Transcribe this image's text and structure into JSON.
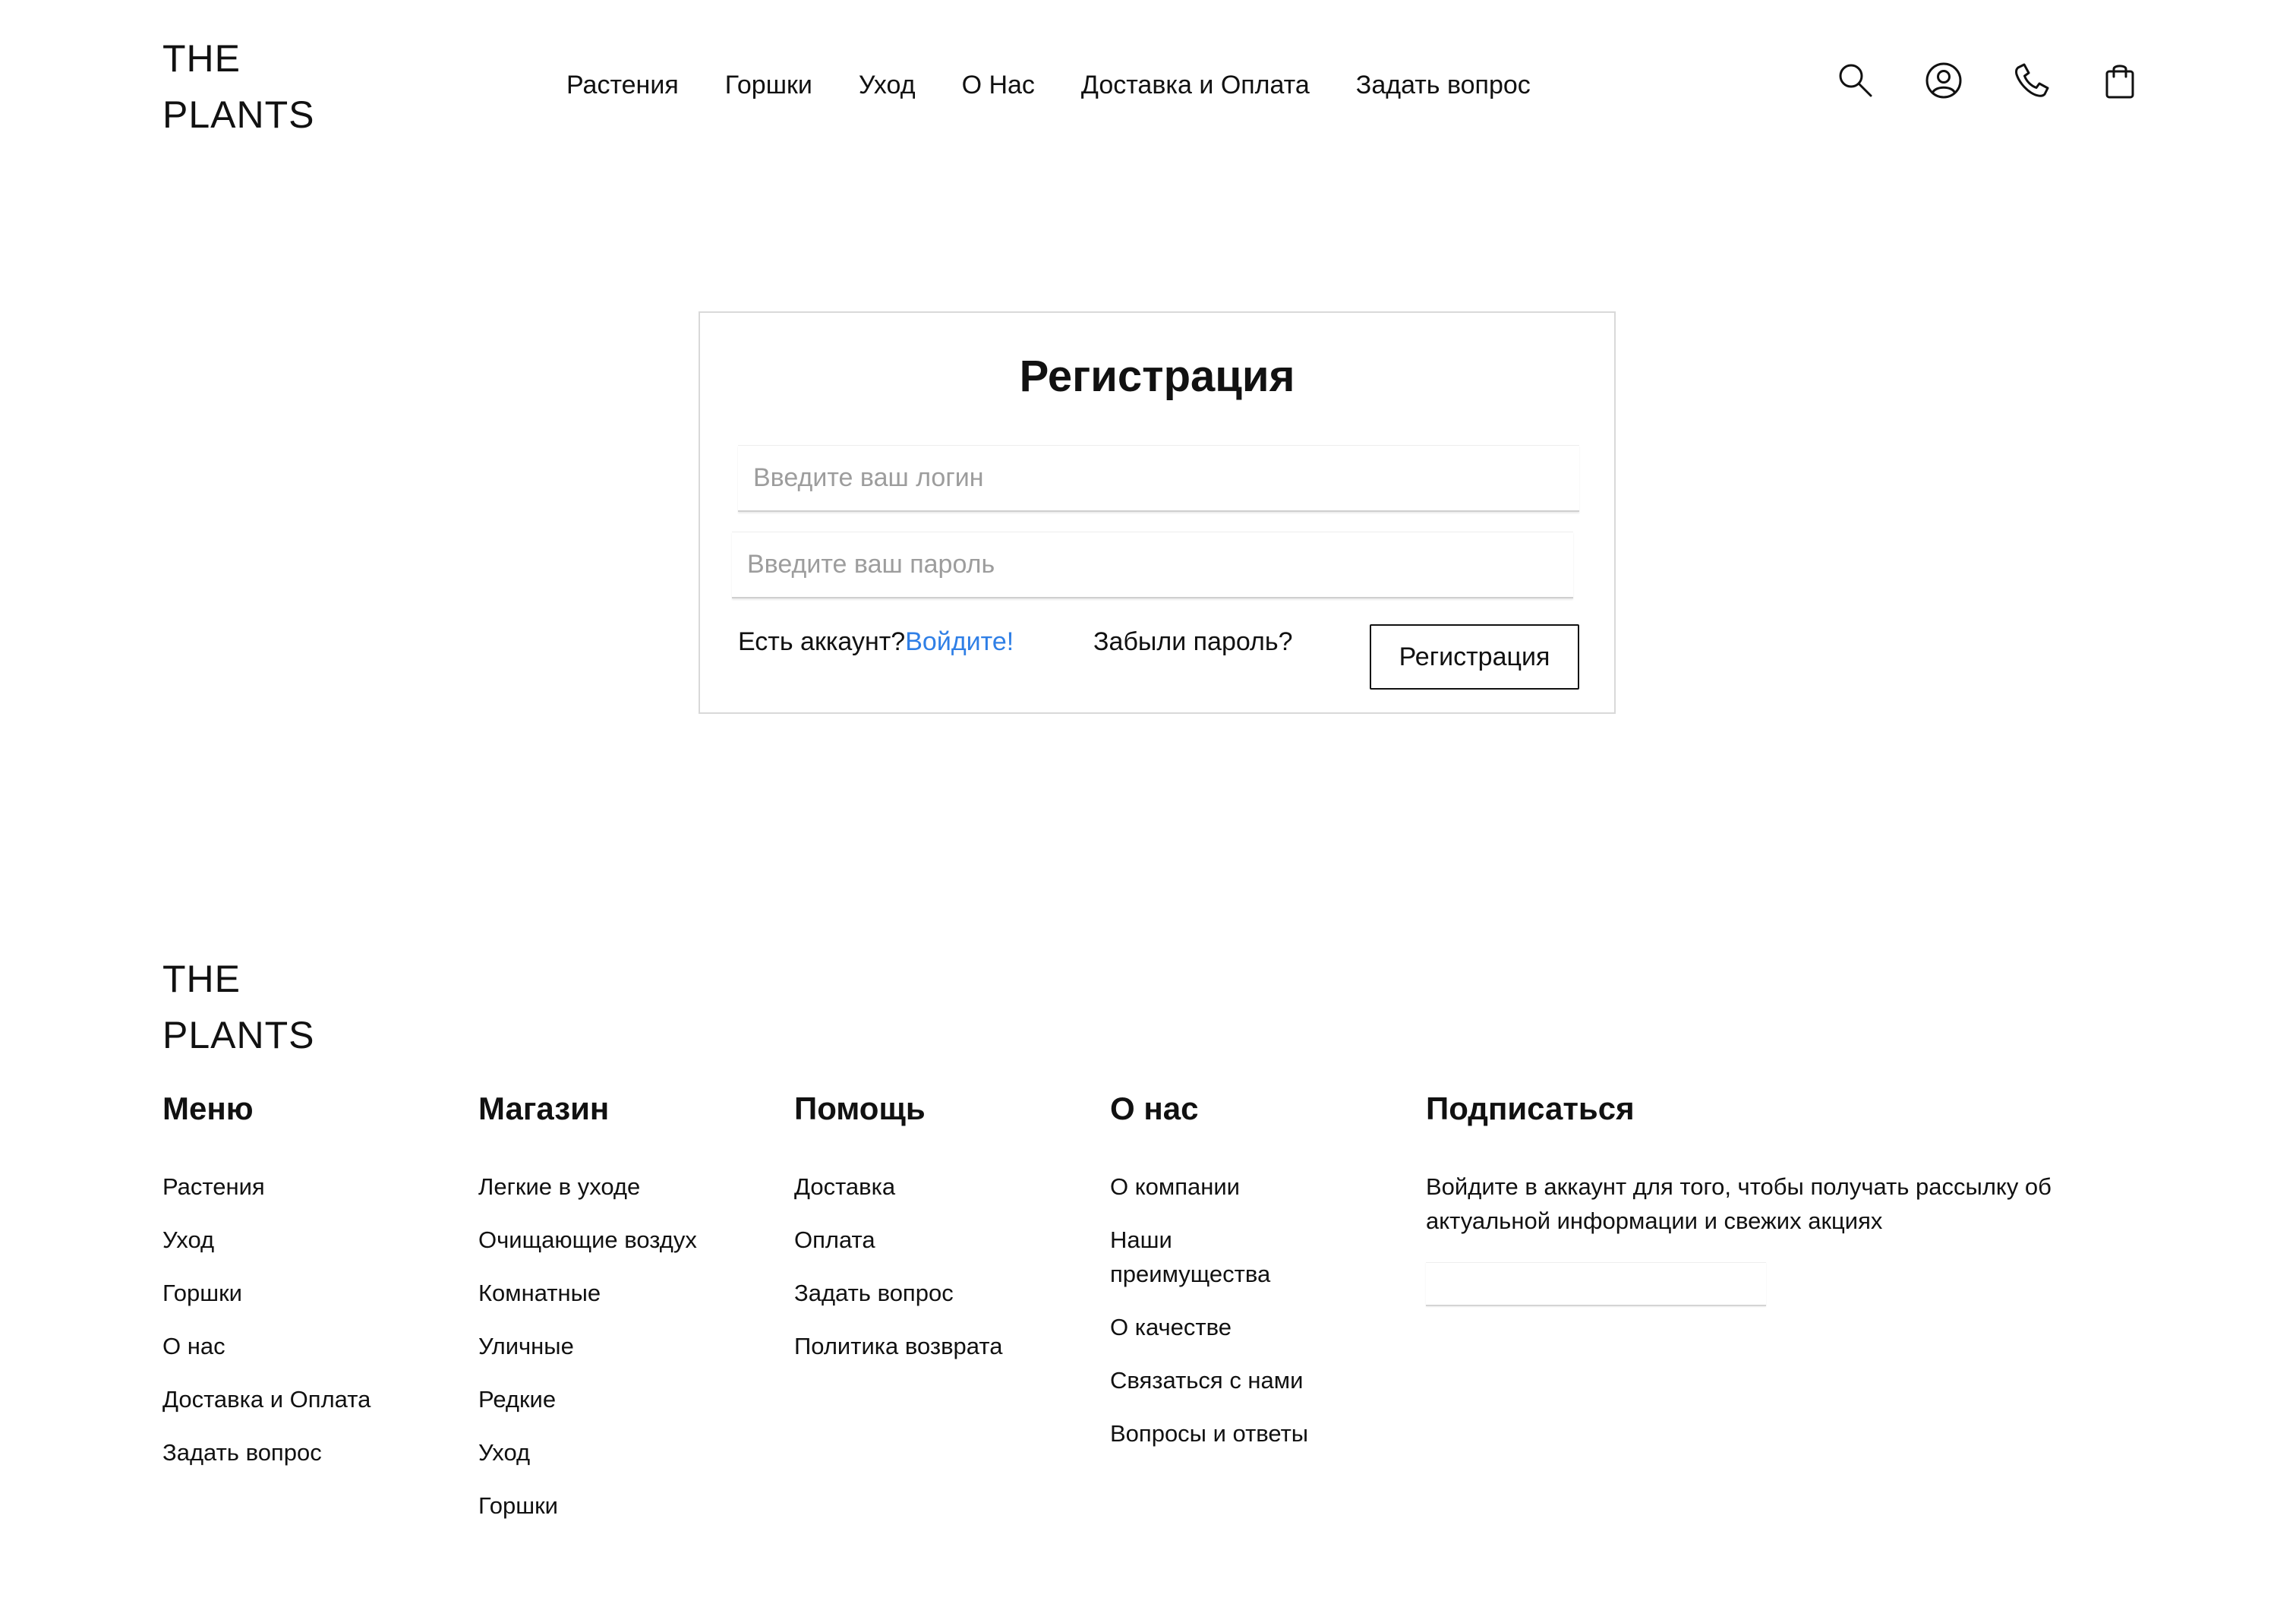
{
  "header": {
    "logo_line1": "THE",
    "logo_line2": "PLANTS",
    "nav": [
      "Растения",
      "Горшки",
      "Уход",
      "О Нас",
      "Доставка и Оплата",
      "Задать вопрос"
    ],
    "icons": [
      "search-icon",
      "user-icon",
      "phone-icon",
      "shopping-bag-icon"
    ]
  },
  "registration": {
    "title": "Регистрация",
    "login_placeholder": "Введите ваш логин",
    "password_placeholder": "Введите ваш пароль",
    "has_account_text": "Есть аккаунт?",
    "login_link": "Войдите!",
    "forgot_password": "Забыли пароль?",
    "submit_label": "Регистрация",
    "link_color": "#2f7fe6"
  },
  "footer": {
    "logo_line1": "THE",
    "logo_line2": "PLANTS",
    "menu": {
      "title": "Меню",
      "items": [
        "Растения",
        "Уход",
        "Горшки",
        "О нас",
        "Доставка и Оплата",
        "Задать вопрос"
      ]
    },
    "shop": {
      "title": "Магазин",
      "items": [
        "Легкие в уходе",
        "Очищающие воздух",
        "Комнатные",
        "Уличные",
        "Редкие",
        "Уход",
        "Горшки"
      ]
    },
    "help": {
      "title": "Помощь",
      "items": [
        "Доставка",
        "Оплата",
        "Задать вопрос",
        "Политика возврата"
      ]
    },
    "about": {
      "title": "О нас",
      "items": [
        "О компании",
        "Наши преимущества",
        "О качестве",
        "Связаться с нами",
        "Вопросы и ответы"
      ]
    },
    "subscribe": {
      "title": "Подписаться",
      "text": "Войдите в аккаунт для того, чтобы получать рассылку об актуальной информации и свежих акциях",
      "input_value": ""
    }
  }
}
